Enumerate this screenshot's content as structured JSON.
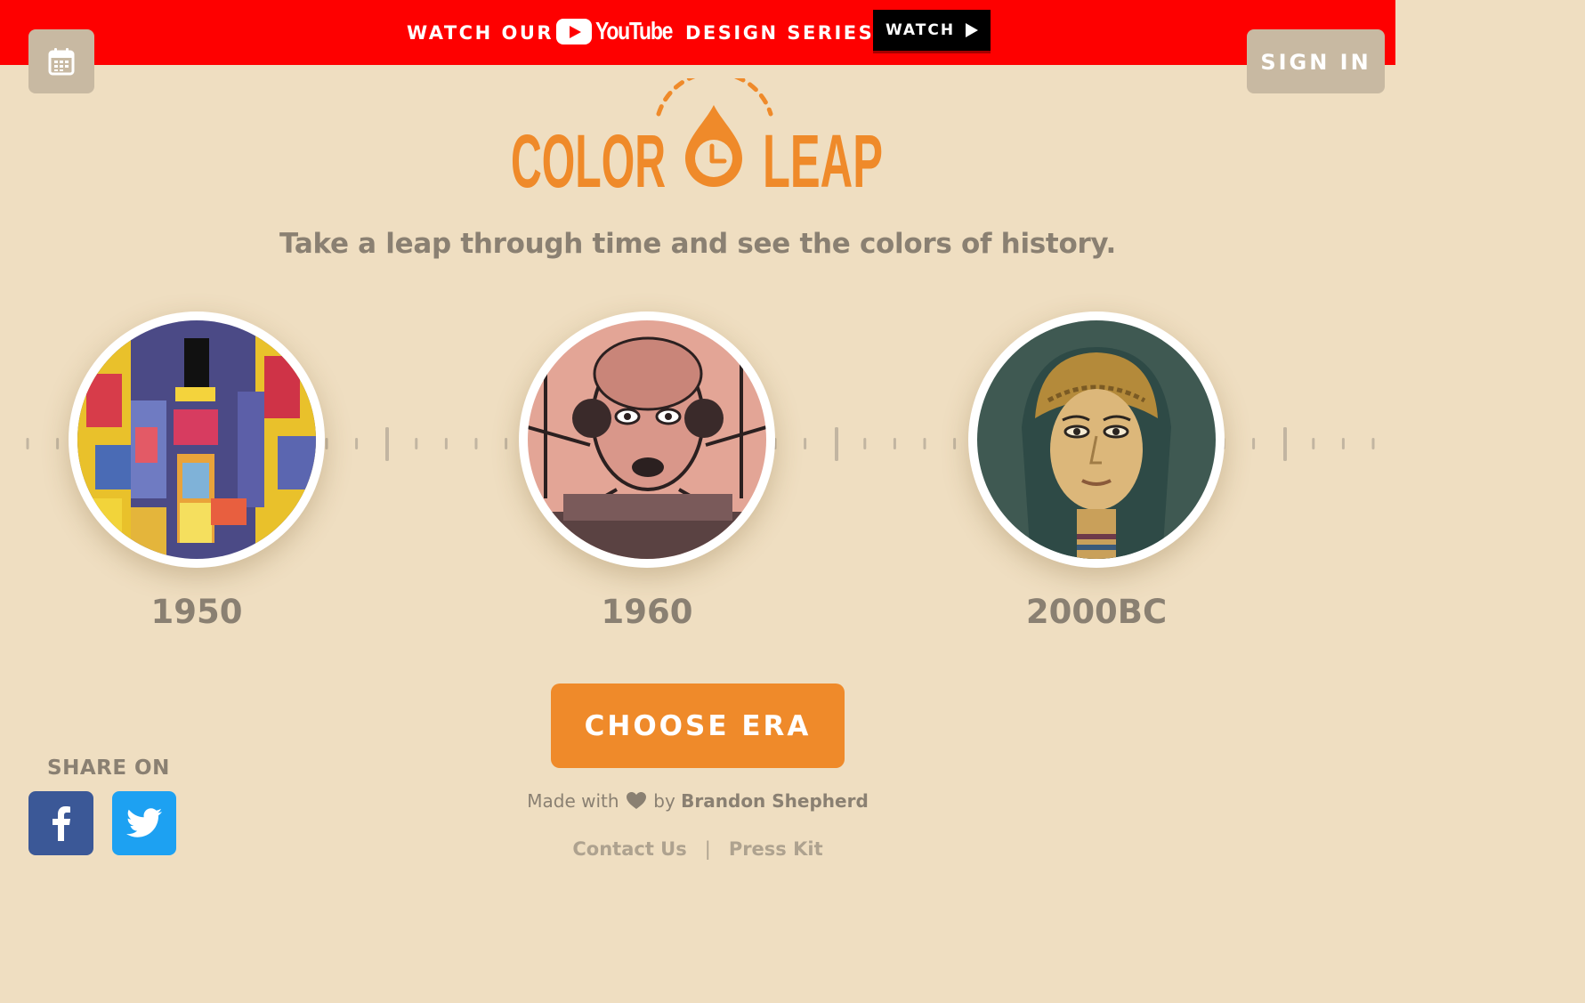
{
  "banner": {
    "prefix": "WATCH OUR",
    "brand": "YouTube",
    "suffix": "DESIGN SERIES",
    "watch_label": "WATCH",
    "color": "#fe0000"
  },
  "header": {
    "calendar_icon": "calendar-icon",
    "sign_in_label": "SIGN IN"
  },
  "logo": {
    "word_left": "COLOR",
    "word_right": "LEAP",
    "color": "#ef8a2a"
  },
  "tagline": "Take a leap through time and see the colors of history.",
  "eras": [
    {
      "label": "1950"
    },
    {
      "label": "1960"
    },
    {
      "label": "2000BC"
    }
  ],
  "choose_button": "CHOOSE ERA",
  "share": {
    "label": "SHARE ON",
    "facebook_icon": "facebook-icon",
    "twitter_icon": "twitter-icon"
  },
  "credit": {
    "prefix": "Made with",
    "connector": "by",
    "author": "Brandon Shepherd"
  },
  "footer": {
    "links": [
      "Contact Us",
      "Press Kit"
    ],
    "separator": "|"
  }
}
